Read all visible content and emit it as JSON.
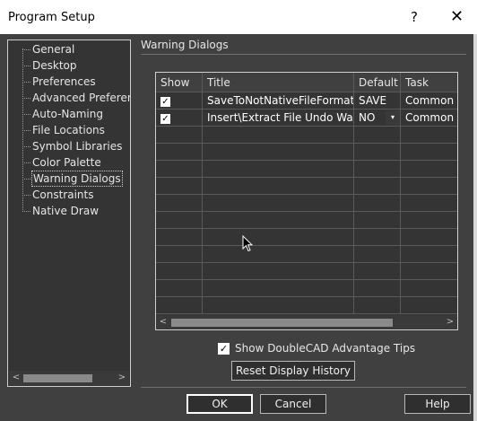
{
  "window": {
    "title": "Program Setup",
    "help_glyph": "?",
    "close_glyph": "✕"
  },
  "tree": {
    "items": [
      {
        "label": "General"
      },
      {
        "label": "Desktop"
      },
      {
        "label": "Preferences"
      },
      {
        "label": "Advanced Preferences"
      },
      {
        "label": "Auto-Naming"
      },
      {
        "label": "File Locations"
      },
      {
        "label": "Symbol Libraries"
      },
      {
        "label": "Color Palette"
      },
      {
        "label": "Warning Dialogs",
        "selected": true
      },
      {
        "label": "Constraints"
      },
      {
        "label": "Native Draw"
      }
    ],
    "scroll_left": "<",
    "scroll_right": ">"
  },
  "section": {
    "title": "Warning Dialogs"
  },
  "grid": {
    "columns": [
      "Show",
      "Title",
      "Default",
      "Task"
    ],
    "rows": [
      {
        "show": "✓",
        "title": "SaveToNotNativeFileFormat",
        "default": "SAVE",
        "task": "Common"
      },
      {
        "show": "✓",
        "title": "Insert\\Extract File Undo War...",
        "default": "NO",
        "task": "Common",
        "dropdown": "▾"
      }
    ],
    "scroll_left": "<",
    "scroll_right": ">"
  },
  "tips": {
    "checked_glyph": "✓",
    "label": "Show DoubleCAD Advantage Tips"
  },
  "buttons": {
    "reset": "Reset Display History",
    "ok": "OK",
    "cancel": "Cancel",
    "help": "Help"
  },
  "colors": {
    "panel": "#404040",
    "list_bg": "#343434",
    "titlebar": "#ffffff"
  }
}
